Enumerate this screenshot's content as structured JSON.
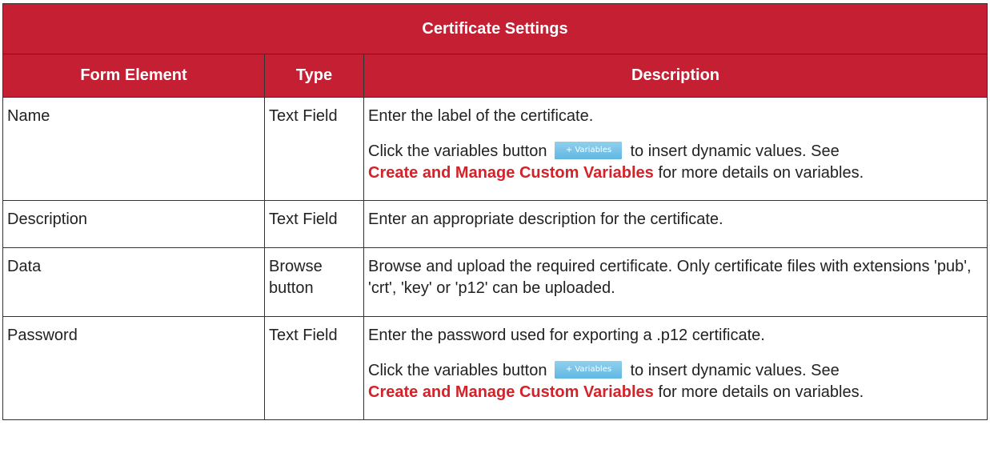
{
  "table": {
    "title": "Certificate Settings",
    "headers": {
      "form_element": "Form Element",
      "type": "Type",
      "description": "Description"
    },
    "rows": [
      {
        "element": "Name",
        "type": "Text Field",
        "desc1": "Enter the label of the certificate.",
        "desc2_pre": "Click the variables button",
        "desc2_mid": "to insert dynamic values. See",
        "link": "Create and Manage Custom Variables",
        "desc2_post": "for more details on variables."
      },
      {
        "element": "Description",
        "type": "Text Field",
        "desc1": "Enter an appropriate description for the certificate."
      },
      {
        "element": "Data",
        "type": "Browse button",
        "desc1": "Browse and upload the required certificate. Only certificate files with extensions 'pub', 'crt', 'key' or 'p12' can be uploaded."
      },
      {
        "element": "Password",
        "type": "Text Field",
        "desc1": "Enter the password used for exporting a .p12 certificate.",
        "desc2_pre": "Click the variables button",
        "desc2_mid": "to insert dynamic values. See",
        "link": "Create and Manage Custom Variables",
        "desc2_post": "for more details on variables."
      }
    ]
  },
  "variables_button": {
    "label": "+ Variables",
    "color": "#6fc0e8"
  },
  "colors": {
    "header_bg": "#c41f32",
    "link": "#d2232a"
  }
}
